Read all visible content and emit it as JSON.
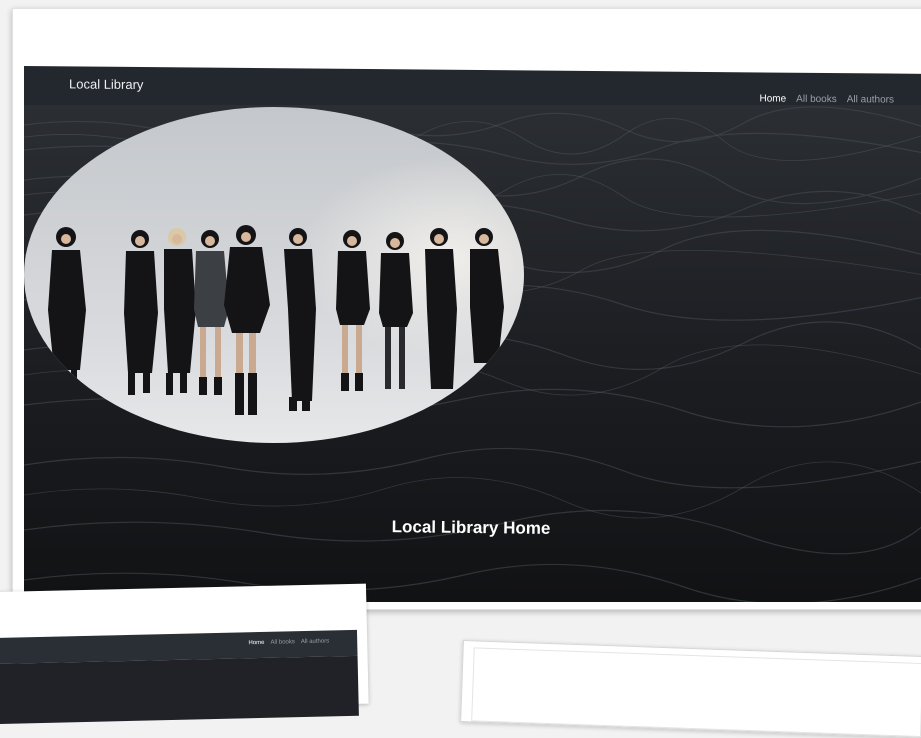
{
  "navbar": {
    "brand": "Local Library",
    "links": [
      {
        "label": "Home",
        "active": true
      },
      {
        "label": "All books",
        "active": false
      },
      {
        "label": "All authors",
        "active": false
      }
    ]
  },
  "hero": {
    "title": "Local Library Home"
  },
  "secondary_card": {
    "links": [
      {
        "label": "Home",
        "active": true
      },
      {
        "label": "All books",
        "active": false
      },
      {
        "label": "All authors",
        "active": false
      }
    ]
  },
  "colors": {
    "navbar_bg": "#23272e",
    "nav_active": "#ffffff",
    "nav_inactive": "#9aa0a8",
    "hero_bg": "#1b1d22"
  }
}
